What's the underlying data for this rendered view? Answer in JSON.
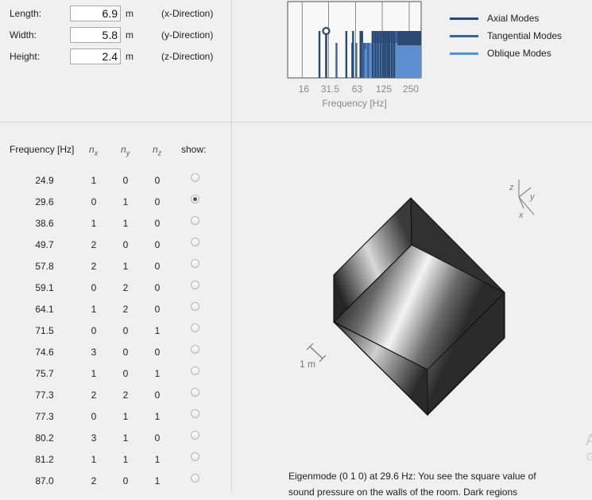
{
  "dimensions": [
    {
      "label": "Length:",
      "value": "6.9",
      "unit": "m",
      "direction": "(x-Direction)"
    },
    {
      "label": "Width:",
      "value": "5.8",
      "unit": "m",
      "direction": "(y-Direction)"
    },
    {
      "label": "Height:",
      "value": "2.4",
      "unit": "m",
      "direction": "(z-Direction)"
    }
  ],
  "spectrum": {
    "x_ticks": [
      "16",
      "31.5",
      "63",
      "125",
      "250"
    ],
    "x_label": "Frequency [Hz]",
    "selected_frequency_hz": 29.6,
    "colors": {
      "axial": "#2c4a70",
      "tangential": "#3d6199",
      "oblique": "#5b8fd0"
    }
  },
  "legend": [
    "Axial Modes",
    "Tangential Modes",
    "Oblique Modes"
  ],
  "table": {
    "headers": {
      "frequency": "Frequency [Hz]",
      "nx": "n",
      "nx_sub": "x",
      "ny": "n",
      "ny_sub": "y",
      "nz": "n",
      "nz_sub": "z",
      "show": "show:"
    },
    "rows": [
      {
        "f": "24.9",
        "nx": "1",
        "ny": "0",
        "nz": "0",
        "selected": false
      },
      {
        "f": "29.6",
        "nx": "0",
        "ny": "1",
        "nz": "0",
        "selected": true
      },
      {
        "f": "38.6",
        "nx": "1",
        "ny": "1",
        "nz": "0",
        "selected": false
      },
      {
        "f": "49.7",
        "nx": "2",
        "ny": "0",
        "nz": "0",
        "selected": false
      },
      {
        "f": "57.8",
        "nx": "2",
        "ny": "1",
        "nz": "0",
        "selected": false
      },
      {
        "f": "59.1",
        "nx": "0",
        "ny": "2",
        "nz": "0",
        "selected": false
      },
      {
        "f": "64.1",
        "nx": "1",
        "ny": "2",
        "nz": "0",
        "selected": false
      },
      {
        "f": "71.5",
        "nx": "0",
        "ny": "0",
        "nz": "1",
        "selected": false
      },
      {
        "f": "74.6",
        "nx": "3",
        "ny": "0",
        "nz": "0",
        "selected": false
      },
      {
        "f": "75.7",
        "nx": "1",
        "ny": "0",
        "nz": "1",
        "selected": false
      },
      {
        "f": "77.3",
        "nx": "2",
        "ny": "2",
        "nz": "0",
        "selected": false
      },
      {
        "f": "77.3",
        "nx": "0",
        "ny": "1",
        "nz": "1",
        "selected": false
      },
      {
        "f": "80.2",
        "nx": "3",
        "ny": "1",
        "nz": "0",
        "selected": false
      },
      {
        "f": "81.2",
        "nx": "1",
        "ny": "1",
        "nz": "1",
        "selected": false
      },
      {
        "f": "87.0",
        "nx": "2",
        "ny": "0",
        "nz": "1",
        "selected": false
      }
    ]
  },
  "view3d": {
    "scale_label": "1 m",
    "axis_labels": {
      "x": "x",
      "y": "y",
      "z": "z"
    }
  },
  "description": "Eigenmode (0 1 0) at 29.6 Hz: You see the square value of sound pressure on the walls of the room. Dark regions",
  "edge_glyphs": [
    "A",
    "G"
  ]
}
